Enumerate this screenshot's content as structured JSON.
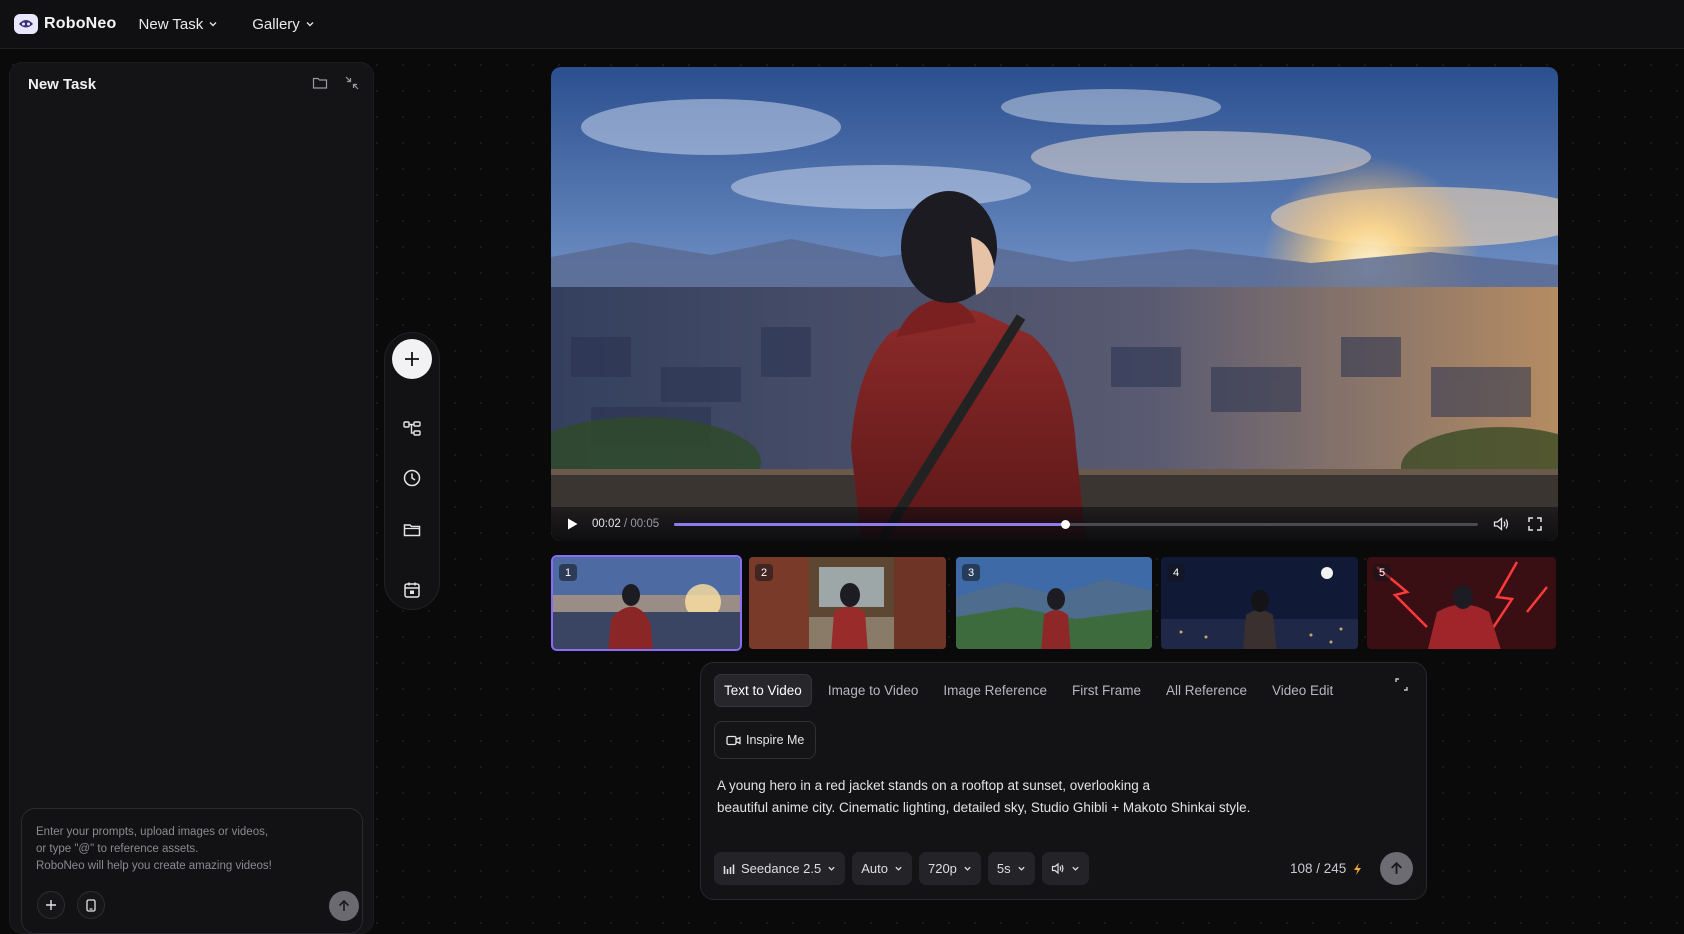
{
  "app": {
    "name": "RoboNeo"
  },
  "nav": {
    "new_task": "New Task",
    "gallery": "Gallery"
  },
  "left_panel": {
    "title": "New Task",
    "chat": {
      "placeholder_line1": "Enter your prompts, upload images or videos,",
      "placeholder_line2": "or type \"@\" to reference assets.",
      "placeholder_line3": "RoboNeo will help you create amazing videos!"
    }
  },
  "tool_rail": [
    "add",
    "workflow",
    "history",
    "folder",
    "calendar"
  ],
  "player": {
    "current_time": "00:02",
    "separator": "/",
    "duration": "00:05",
    "progress": 0.486
  },
  "thumbnails": [
    {
      "num": "1",
      "scene": "sunset-rooftop",
      "active": true
    },
    {
      "num": "2",
      "scene": "street-market",
      "active": false
    },
    {
      "num": "3",
      "scene": "mountain-valley",
      "active": false
    },
    {
      "num": "4",
      "scene": "night-city-moon",
      "active": false
    },
    {
      "num": "5",
      "scene": "red-lightning",
      "active": false
    }
  ],
  "prompt_panel": {
    "tabs": [
      "Text to Video",
      "Image to Video",
      "Image Reference",
      "First Frame",
      "All Reference",
      "Video Edit"
    ],
    "active_tab": 0,
    "inspire": "Inspire Me",
    "prompt_line1": "A young hero in a red jacket stands on a rooftop at sunset, overlooking a",
    "prompt_line2": "beautiful anime city. Cinematic lighting, detailed sky, Studio Ghibli + Makoto Shinkai style.",
    "options": {
      "model": "Seedance 2.5",
      "ratio": "Auto",
      "resolution": "720p",
      "length": "5s"
    },
    "credits": "108 / 245"
  },
  "colors": {
    "accent": "#8b6cf5",
    "background": "#0a0a0b",
    "panel": "#141416"
  }
}
